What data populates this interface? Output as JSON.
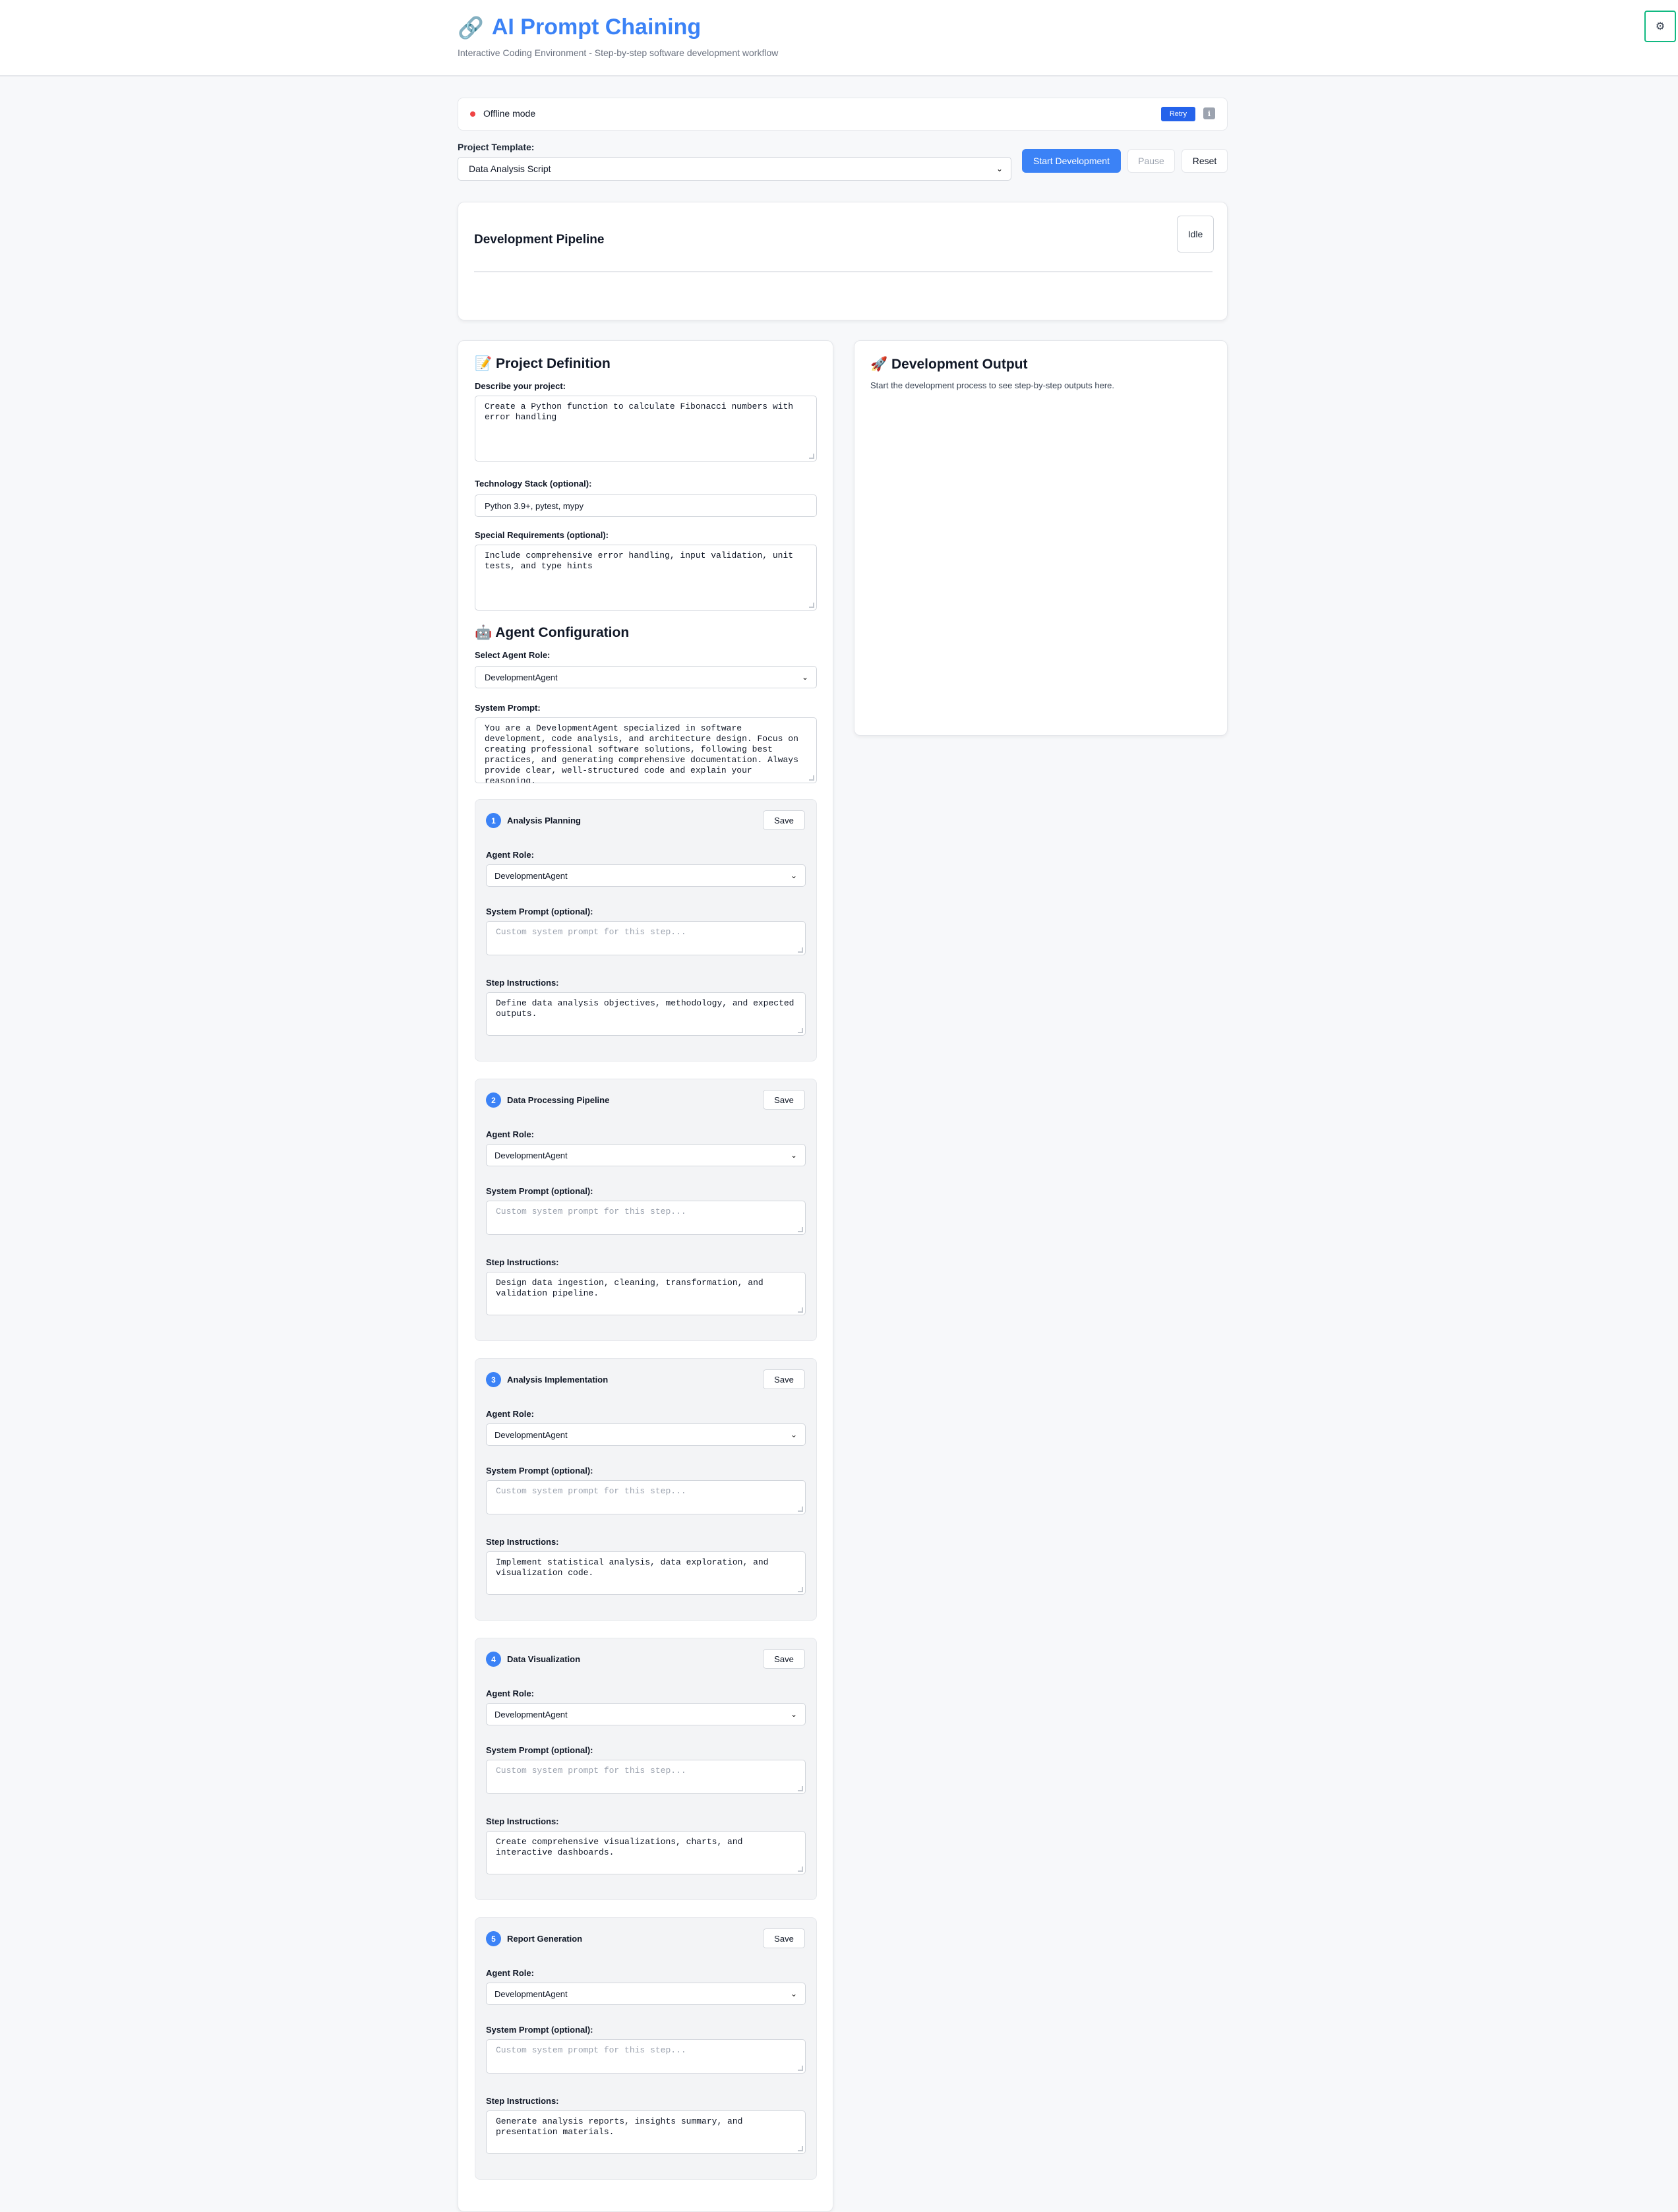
{
  "header": {
    "title": "AI Prompt Chaining",
    "title_icon": "link-icon",
    "subtitle": "Interactive Coding Environment - Step-by-step software development workflow",
    "settings_icon": "gear-icon"
  },
  "status": {
    "text": "Offline mode",
    "dot_color": "#ef4444",
    "retry_label": "Retry",
    "info_icon": "info-icon"
  },
  "template": {
    "label": "Project Template:",
    "selected": "Data Analysis Script"
  },
  "controls": {
    "start_label": "Start Development",
    "pause_label": "Pause",
    "reset_label": "Reset"
  },
  "pipeline": {
    "title": "Development Pipeline",
    "state": "Idle"
  },
  "project": {
    "title": "📝 Project Definition",
    "describe_label": "Describe your project:",
    "describe_value": "Create a Python function to calculate Fibonacci numbers with error handling",
    "tech_label": "Technology Stack (optional):",
    "tech_value": "Python 3.9+, pytest, mypy",
    "requirements_label": "Special Requirements (optional):",
    "requirements_value": "Include comprehensive error handling, input validation, unit tests, and type hints"
  },
  "agent": {
    "title": "🤖 Agent Configuration",
    "role_label": "Select Agent Role:",
    "role_value": "DevelopmentAgent",
    "prompt_label": "System Prompt:",
    "prompt_value": "You are a DevelopmentAgent specialized in software development, code analysis, and architecture design. Focus on creating professional software solutions, following best practices, and generating comprehensive documentation. Always provide clear, well-structured code and explain your reasoning."
  },
  "output": {
    "title": "🚀 Development Output",
    "empty_text": "Start the development process to see step-by-step outputs here."
  },
  "step_common": {
    "save_label": "Save",
    "role_label": "Agent Role:",
    "prompt_label": "System Prompt (optional):",
    "prompt_placeholder": "Custom system prompt for this step...",
    "instructions_label": "Step Instructions:"
  },
  "steps": [
    {
      "num": "1",
      "title": "Analysis Planning",
      "role": "DevelopmentAgent",
      "instructions": "Define data analysis objectives, methodology, and expected outputs."
    },
    {
      "num": "2",
      "title": "Data Processing Pipeline",
      "role": "DevelopmentAgent",
      "instructions": "Design data ingestion, cleaning, transformation, and validation pipeline."
    },
    {
      "num": "3",
      "title": "Analysis Implementation",
      "role": "DevelopmentAgent",
      "instructions": "Implement statistical analysis, data exploration, and visualization code."
    },
    {
      "num": "4",
      "title": "Data Visualization",
      "role": "DevelopmentAgent",
      "instructions": "Create comprehensive visualizations, charts, and interactive dashboards."
    },
    {
      "num": "5",
      "title": "Report Generation",
      "role": "DevelopmentAgent",
      "instructions": "Generate analysis reports, insights summary, and presentation materials."
    }
  ]
}
